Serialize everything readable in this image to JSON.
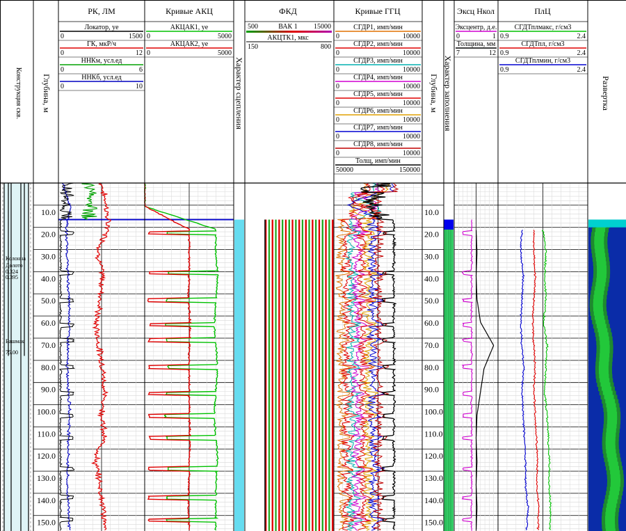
{
  "columns": {
    "construction": "Конструкция скв.",
    "depth_left": "Глубина, м",
    "rk": "РК, ЛМ",
    "akc": "Кривые АКЦ",
    "coupling": "Характер сцепления",
    "fkd": "ФКД",
    "ggc": "Кривые ГГЦ",
    "depth_right": "Глубина, м",
    "fill": "Характер заполнения",
    "exc": "Эксц Нкол",
    "plc": "ПлЦ",
    "sweep": "Развертка"
  },
  "curves": {
    "rk": [
      {
        "label": "Локатор, ye",
        "min": "0",
        "max": "1500",
        "color": "#000000"
      },
      {
        "label": "ГК, мкР/ч",
        "min": "0",
        "max": "12",
        "color": "#e00000"
      },
      {
        "label": "ННКм, усл.ед",
        "min": "0",
        "max": "6",
        "color": "#00a000"
      },
      {
        "label": "ННКб, усл.ед",
        "min": "0",
        "max": "10",
        "color": "#0000c0"
      }
    ],
    "akc": [
      {
        "label": "АКЦАК1, ye",
        "min": "0",
        "max": "5000",
        "color": "#00c000"
      },
      {
        "label": "АКЦАК2, ye",
        "min": "0",
        "max": "5000",
        "color": "#e00000"
      }
    ],
    "fkd": [
      {
        "label": "ВАК 1",
        "min": "500",
        "max": "15000",
        "color": "#00a000"
      },
      {
        "label": "АКЦТК1, мкс",
        "min": "150",
        "max": "800",
        "color": "#000000"
      }
    ],
    "ggc": [
      {
        "label": "СГДР1, имп/мин",
        "min": "0",
        "max": "10000",
        "color": "#e07000"
      },
      {
        "label": "СГДР2, имп/мин",
        "min": "0",
        "max": "10000",
        "color": "#e00000"
      },
      {
        "label": "СГДР3, имп/мин",
        "min": "0",
        "max": "10000",
        "color": "#00b0b0"
      },
      {
        "label": "СГДР4, имп/мин",
        "min": "0",
        "max": "10000",
        "color": "#d000d0"
      },
      {
        "label": "СГДР5, имп/мин",
        "min": "0",
        "max": "10000",
        "color": "#e00000"
      },
      {
        "label": "СГДР6, имп/мин",
        "min": "0",
        "max": "10000",
        "color": "#e0a000"
      },
      {
        "label": "СГДР7, имп/мин",
        "min": "0",
        "max": "10000",
        "color": "#0000d0"
      },
      {
        "label": "СГДР8, имп/мин",
        "min": "0",
        "max": "10000",
        "color": "#c00000"
      },
      {
        "label": "Толщ, имп/мин",
        "min": "50000",
        "max": "150000",
        "color": "#000000"
      }
    ],
    "exc": [
      {
        "label": "Эксцентр, д.е.",
        "min": "0",
        "max": "1",
        "color": "#d000d0"
      },
      {
        "label": "Толщина, мм",
        "min": "7",
        "max": "12",
        "color": "#000000"
      }
    ],
    "plc": [
      {
        "label": "СГДТплмакс, г/см3",
        "min": "0.9",
        "max": "2.4",
        "color": "#00c000"
      },
      {
        "label": "СГДТпл, г/см3",
        "min": "0.9",
        "max": "2.4",
        "color": "#e00000"
      },
      {
        "label": "СГДТплмин, г/см3",
        "min": "0.9",
        "max": "2.4",
        "color": "#0000d0"
      }
    ]
  },
  "construction_notes": [
    "Колонна",
    "Долото",
    "0.324",
    "0.395",
    "Башмак",
    "75.00"
  ],
  "chart_data": {
    "type": "line",
    "title": "",
    "depth_unit": "м",
    "depth_range": [
      0,
      157
    ],
    "depth_ticks": [
      10,
      20,
      30,
      40,
      50,
      60,
      70,
      80,
      90,
      100,
      110,
      120,
      130,
      140,
      150
    ],
    "depth_tick_labels": [
      "10.0",
      "20.0",
      "30.0",
      "40.0",
      "50.0",
      "60.0",
      "70.0",
      "80.0",
      "90.0",
      "100.0",
      "110.0",
      "120.0",
      "130.0",
      "140.0",
      "150.0"
    ],
    "casing_top_depth": 16.5,
    "collars_depth": [
      22.5,
      40.5,
      53,
      64,
      71,
      83,
      95,
      105,
      115,
      129,
      142,
      152
    ],
    "series": [
      {
        "name": "ГК, мкР/ч",
        "track": "rk",
        "range": [
          0,
          12
        ],
        "values": [
          6,
          6.7,
          6.9,
          5.5,
          6.1,
          5.9,
          5.2,
          5.6,
          6.2,
          6.4,
          6.1,
          6.3,
          5.1,
          5.8,
          6.2,
          6.5
        ]
      },
      {
        "name": "ННКб, усл.ед",
        "track": "rk",
        "range": [
          0,
          10
        ],
        "values": [
          0.5,
          1.4,
          0.9,
          1.0,
          1.1,
          1.2,
          1.3,
          1.1,
          1.0,
          1.2,
          1.3,
          1.2,
          1.1,
          1.0,
          1.2,
          1.3
        ]
      },
      {
        "name": "АКЦАК1, ye",
        "track": "akc",
        "range": [
          0,
          5000
        ],
        "values": [
          0,
          0,
          4000,
          4000,
          4100,
          4000,
          3900,
          4000,
          4100,
          4000,
          3900,
          4000,
          4100,
          4000,
          4000,
          4000
        ]
      },
      {
        "name": "АКЦАК2, ye",
        "track": "akc",
        "range": [
          0,
          5000
        ],
        "values": [
          0,
          0,
          2500,
          2500,
          2500,
          2450,
          2550,
          2500,
          2500,
          2500,
          2500,
          2550,
          2500,
          2500,
          2450,
          2500
        ]
      },
      {
        "name": "Толщина, мм",
        "track": "exc",
        "range": [
          7,
          12
        ],
        "values": [
          null,
          null,
          9.5,
          9.6,
          9.5,
          9.6,
          10,
          11.5,
          10.4,
          10,
          9.6,
          9.5,
          9.6,
          9.5,
          9.6,
          9.5
        ]
      },
      {
        "name": "СГДТплмакс, г/см3",
        "track": "plc",
        "range": [
          0.9,
          2.4
        ],
        "values": [
          null,
          null,
          1.65,
          1.7,
          1.68,
          1.7,
          1.66,
          1.72,
          1.7,
          1.68,
          1.72,
          1.74,
          1.76,
          1.75,
          1.78,
          1.77
        ]
      },
      {
        "name": "СГДТпл, г/см3",
        "track": "plc",
        "range": [
          0.9,
          2.4
        ],
        "values": [
          null,
          null,
          1.5,
          1.5,
          1.52,
          1.5,
          1.48,
          1.5,
          1.52,
          1.5,
          1.52,
          1.54,
          1.56,
          1.55,
          1.58,
          1.57
        ]
      },
      {
        "name": "СГДТплмин, г/см3",
        "track": "plc",
        "range": [
          0.9,
          2.4
        ],
        "values": [
          null,
          null,
          1.3,
          1.28,
          1.32,
          1.3,
          1.28,
          1.3,
          1.33,
          1.3,
          1.32,
          1.34,
          1.36,
          1.36,
          1.4,
          1.38
        ]
      }
    ]
  }
}
